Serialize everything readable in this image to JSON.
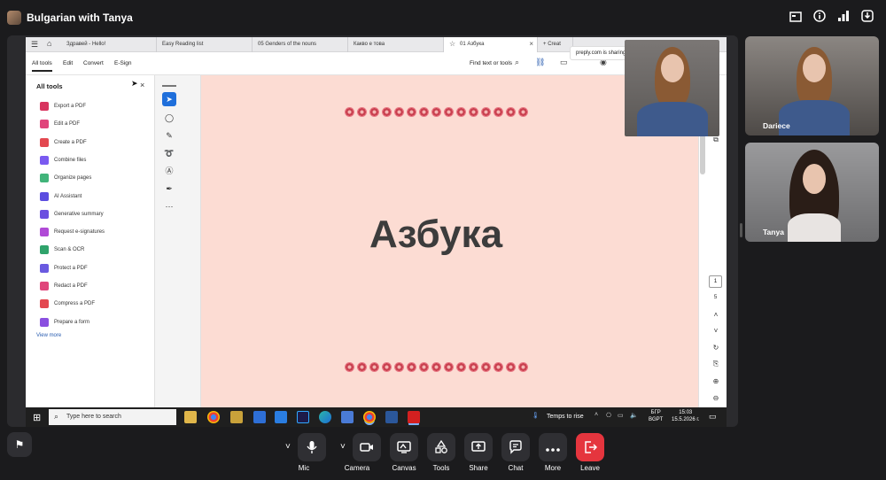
{
  "meeting": {
    "title": "Bulgarian with Tanya",
    "top_icons": [
      "screen-icon",
      "info-icon",
      "signal-icon",
      "download-icon"
    ]
  },
  "browser": {
    "tabs": [
      {
        "label": "Здравей - Hello!",
        "active": false
      },
      {
        "label": "Easy Reading list",
        "active": false
      },
      {
        "label": "05 Genders of the nouns",
        "active": false
      },
      {
        "label": "Какво е това",
        "active": false
      },
      {
        "label": "01 Азбука",
        "active": true,
        "close": "×"
      },
      {
        "label": "Creat",
        "active": false
      }
    ],
    "new_tab": "+",
    "sharing_banner": "preply.com is sharing"
  },
  "acrobat": {
    "menu": [
      "All tools",
      "Edit",
      "Convert",
      "E-Sign"
    ],
    "find": "Find text or tools",
    "panel_title": "All tools",
    "tools": [
      {
        "label": "Export a PDF",
        "color": "#d8345f"
      },
      {
        "label": "Edit a PDF",
        "color": "#e0457b"
      },
      {
        "label": "Create a PDF",
        "color": "#e34850"
      },
      {
        "label": "Combine files",
        "color": "#7a5af0"
      },
      {
        "label": "Organize pages",
        "color": "#41b47a"
      },
      {
        "label": "AI Assistant",
        "color": "#5b4de0"
      },
      {
        "label": "Generative summary",
        "color": "#6b4fe0"
      },
      {
        "label": "Request e-signatures",
        "color": "#b04ad6"
      },
      {
        "label": "Scan & OCR",
        "color": "#2fa36b"
      },
      {
        "label": "Protect a PDF",
        "color": "#6a5ae0"
      },
      {
        "label": "Redact a PDF",
        "color": "#e0457b"
      },
      {
        "label": "Compress a PDF",
        "color": "#e34850"
      },
      {
        "label": "Prepare a form",
        "color": "#8a4fe0"
      }
    ],
    "view_more": "View more",
    "page_current": "1",
    "page_total": "5"
  },
  "slide": {
    "title": "Азбука",
    "background": "#fcdcd3"
  },
  "taskbar": {
    "search_placeholder": "Type here to search",
    "weather": "Temps to rise",
    "lang_top": "БГР",
    "lang_bottom": "BGPT",
    "time": "15:03",
    "date": "15.5.2026 г."
  },
  "participants": [
    {
      "name": "Dariece"
    },
    {
      "name": "Tanya"
    }
  ],
  "controls": [
    {
      "label": "Mic",
      "icon": "mic-icon"
    },
    {
      "label": "Camera",
      "icon": "camera-icon"
    },
    {
      "label": "Canvas",
      "icon": "canvas-icon"
    },
    {
      "label": "Tools",
      "icon": "tools-icon"
    },
    {
      "label": "Share",
      "icon": "share-icon"
    },
    {
      "label": "Chat",
      "icon": "chat-icon"
    },
    {
      "label": "More",
      "icon": "more-icon"
    },
    {
      "label": "Leave",
      "icon": "leave-icon"
    }
  ],
  "colors": {
    "leave": "#e5353e",
    "accent_blue": "#1f6fdb",
    "background": "#1b1b1d"
  }
}
